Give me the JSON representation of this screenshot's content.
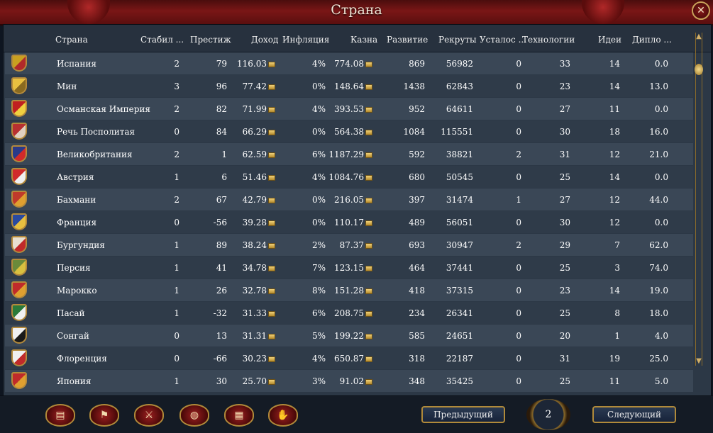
{
  "window": {
    "title": "Страна",
    "close_glyph": "✕"
  },
  "columns": {
    "country": "Страна",
    "stability": "Стабил ...",
    "prestige": "Престиж",
    "income": "Доход",
    "inflation": "Инфляция",
    "treasury": "Казна",
    "development": "Развитие",
    "manpower": "Рекруты",
    "war_exhaustion": "Усталос ...",
    "technology": "Технологии",
    "ideas": "Идеи",
    "diplomacy": "Дипло ..."
  },
  "rows": [
    {
      "country": "Испания",
      "stability": "2",
      "prestige": "79",
      "income": "116.03",
      "inflation": "4%",
      "treasury": "774.08",
      "development": "869",
      "manpower": "56982",
      "war_exhaustion": "0",
      "technology": "33",
      "ideas": "14",
      "diplomacy": "0.0",
      "flag_colors": [
        "#c8a020",
        "#b02a2a"
      ]
    },
    {
      "country": "Мин",
      "stability": "3",
      "prestige": "96",
      "income": "77.42",
      "inflation": "0%",
      "treasury": "148.64",
      "development": "1438",
      "manpower": "62843",
      "war_exhaustion": "0",
      "technology": "23",
      "ideas": "14",
      "diplomacy": "13.0",
      "flag_colors": [
        "#e8c040",
        "#8a6a20"
      ]
    },
    {
      "country": "Османская Империя",
      "stability": "2",
      "prestige": "82",
      "income": "71.99",
      "inflation": "4%",
      "treasury": "393.53",
      "development": "952",
      "manpower": "64611",
      "war_exhaustion": "0",
      "technology": "27",
      "ideas": "11",
      "diplomacy": "0.0",
      "flag_colors": [
        "#c02020",
        "#f0d040"
      ]
    },
    {
      "country": "Речь Посполитая",
      "stability": "0",
      "prestige": "84",
      "income": "66.29",
      "inflation": "0%",
      "treasury": "564.38",
      "development": "1084",
      "manpower": "115551",
      "war_exhaustion": "0",
      "technology": "30",
      "ideas": "18",
      "diplomacy": "16.0",
      "flag_colors": [
        "#b83030",
        "#e0d0c0"
      ]
    },
    {
      "country": "Великобритания",
      "stability": "2",
      "prestige": "1",
      "income": "62.59",
      "inflation": "6%",
      "treasury": "1187.29",
      "development": "592",
      "manpower": "38821",
      "war_exhaustion": "2",
      "technology": "31",
      "ideas": "12",
      "diplomacy": "21.0",
      "flag_colors": [
        "#2a3a8a",
        "#d02a2a"
      ]
    },
    {
      "country": "Австрия",
      "stability": "1",
      "prestige": "6",
      "income": "51.46",
      "inflation": "4%",
      "treasury": "1084.76",
      "development": "680",
      "manpower": "50545",
      "war_exhaustion": "0",
      "technology": "25",
      "ideas": "14",
      "diplomacy": "0.0",
      "flag_colors": [
        "#d02a2a",
        "#f0f0f0"
      ]
    },
    {
      "country": "Бахмани",
      "stability": "2",
      "prestige": "67",
      "income": "42.79",
      "inflation": "0%",
      "treasury": "216.05",
      "development": "397",
      "manpower": "31474",
      "war_exhaustion": "1",
      "technology": "27",
      "ideas": "12",
      "diplomacy": "44.0",
      "flag_colors": [
        "#c03a2a",
        "#e0a030"
      ]
    },
    {
      "country": "Франция",
      "stability": "0",
      "prestige": "-56",
      "income": "39.28",
      "inflation": "0%",
      "treasury": "110.17",
      "development": "489",
      "manpower": "56051",
      "war_exhaustion": "0",
      "technology": "30",
      "ideas": "12",
      "diplomacy": "0.0",
      "flag_colors": [
        "#2a4aa0",
        "#e8c040"
      ]
    },
    {
      "country": "Бургундия",
      "stability": "1",
      "prestige": "89",
      "income": "38.24",
      "inflation": "2%",
      "treasury": "87.37",
      "development": "693",
      "manpower": "30947",
      "war_exhaustion": "2",
      "technology": "29",
      "ideas": "7",
      "diplomacy": "62.0",
      "flag_colors": [
        "#e8e0d0",
        "#c02a2a"
      ]
    },
    {
      "country": "Персия",
      "stability": "1",
      "prestige": "41",
      "income": "34.78",
      "inflation": "7%",
      "treasury": "123.15",
      "development": "464",
      "manpower": "37441",
      "war_exhaustion": "0",
      "technology": "25",
      "ideas": "3",
      "diplomacy": "74.0",
      "flag_colors": [
        "#6a8a3a",
        "#d8c040"
      ]
    },
    {
      "country": "Марокко",
      "stability": "1",
      "prestige": "26",
      "income": "32.78",
      "inflation": "8%",
      "treasury": "151.28",
      "development": "418",
      "manpower": "37315",
      "war_exhaustion": "0",
      "technology": "23",
      "ideas": "14",
      "diplomacy": "19.0",
      "flag_colors": [
        "#c02a2a",
        "#e0a030"
      ]
    },
    {
      "country": "Пасай",
      "stability": "1",
      "prestige": "-32",
      "income": "31.33",
      "inflation": "6%",
      "treasury": "208.75",
      "development": "234",
      "manpower": "26341",
      "war_exhaustion": "0",
      "technology": "25",
      "ideas": "8",
      "diplomacy": "18.0",
      "flag_colors": [
        "#2a7a3a",
        "#f0f0f0"
      ]
    },
    {
      "country": "Сонгай",
      "stability": "0",
      "prestige": "13",
      "income": "31.31",
      "inflation": "5%",
      "treasury": "199.22",
      "development": "585",
      "manpower": "24651",
      "war_exhaustion": "0",
      "technology": "20",
      "ideas": "1",
      "diplomacy": "4.0",
      "flag_colors": [
        "#f0f0f0",
        "#1a1a1a"
      ]
    },
    {
      "country": "Флоренция",
      "stability": "0",
      "prestige": "-66",
      "income": "30.23",
      "inflation": "4%",
      "treasury": "650.87",
      "development": "318",
      "manpower": "22187",
      "war_exhaustion": "0",
      "technology": "31",
      "ideas": "19",
      "diplomacy": "25.0",
      "flag_colors": [
        "#f0f0f0",
        "#c02a2a"
      ]
    },
    {
      "country": "Япония",
      "stability": "1",
      "prestige": "30",
      "income": "25.70",
      "inflation": "3%",
      "treasury": "91.02",
      "development": "348",
      "manpower": "35425",
      "war_exhaustion": "0",
      "technology": "25",
      "ideas": "11",
      "diplomacy": "5.0",
      "flag_colors": [
        "#c02a2a",
        "#e0a030"
      ]
    }
  ],
  "bottom_tabs": [
    {
      "name": "ledger-icon",
      "glyph": "▤"
    },
    {
      "name": "flag-icon",
      "glyph": "⚑"
    },
    {
      "name": "crossed-swords-icon",
      "glyph": "⚔"
    },
    {
      "name": "coins-icon",
      "glyph": "◍"
    },
    {
      "name": "buildings-icon",
      "glyph": "▦"
    },
    {
      "name": "handshake-icon",
      "glyph": "✋"
    }
  ],
  "pagination": {
    "prev_label": "Предыдущий",
    "next_label": "Следующий",
    "page": "2"
  },
  "scrollbar": {
    "up_glyph": "▲",
    "down_glyph": "▼"
  }
}
